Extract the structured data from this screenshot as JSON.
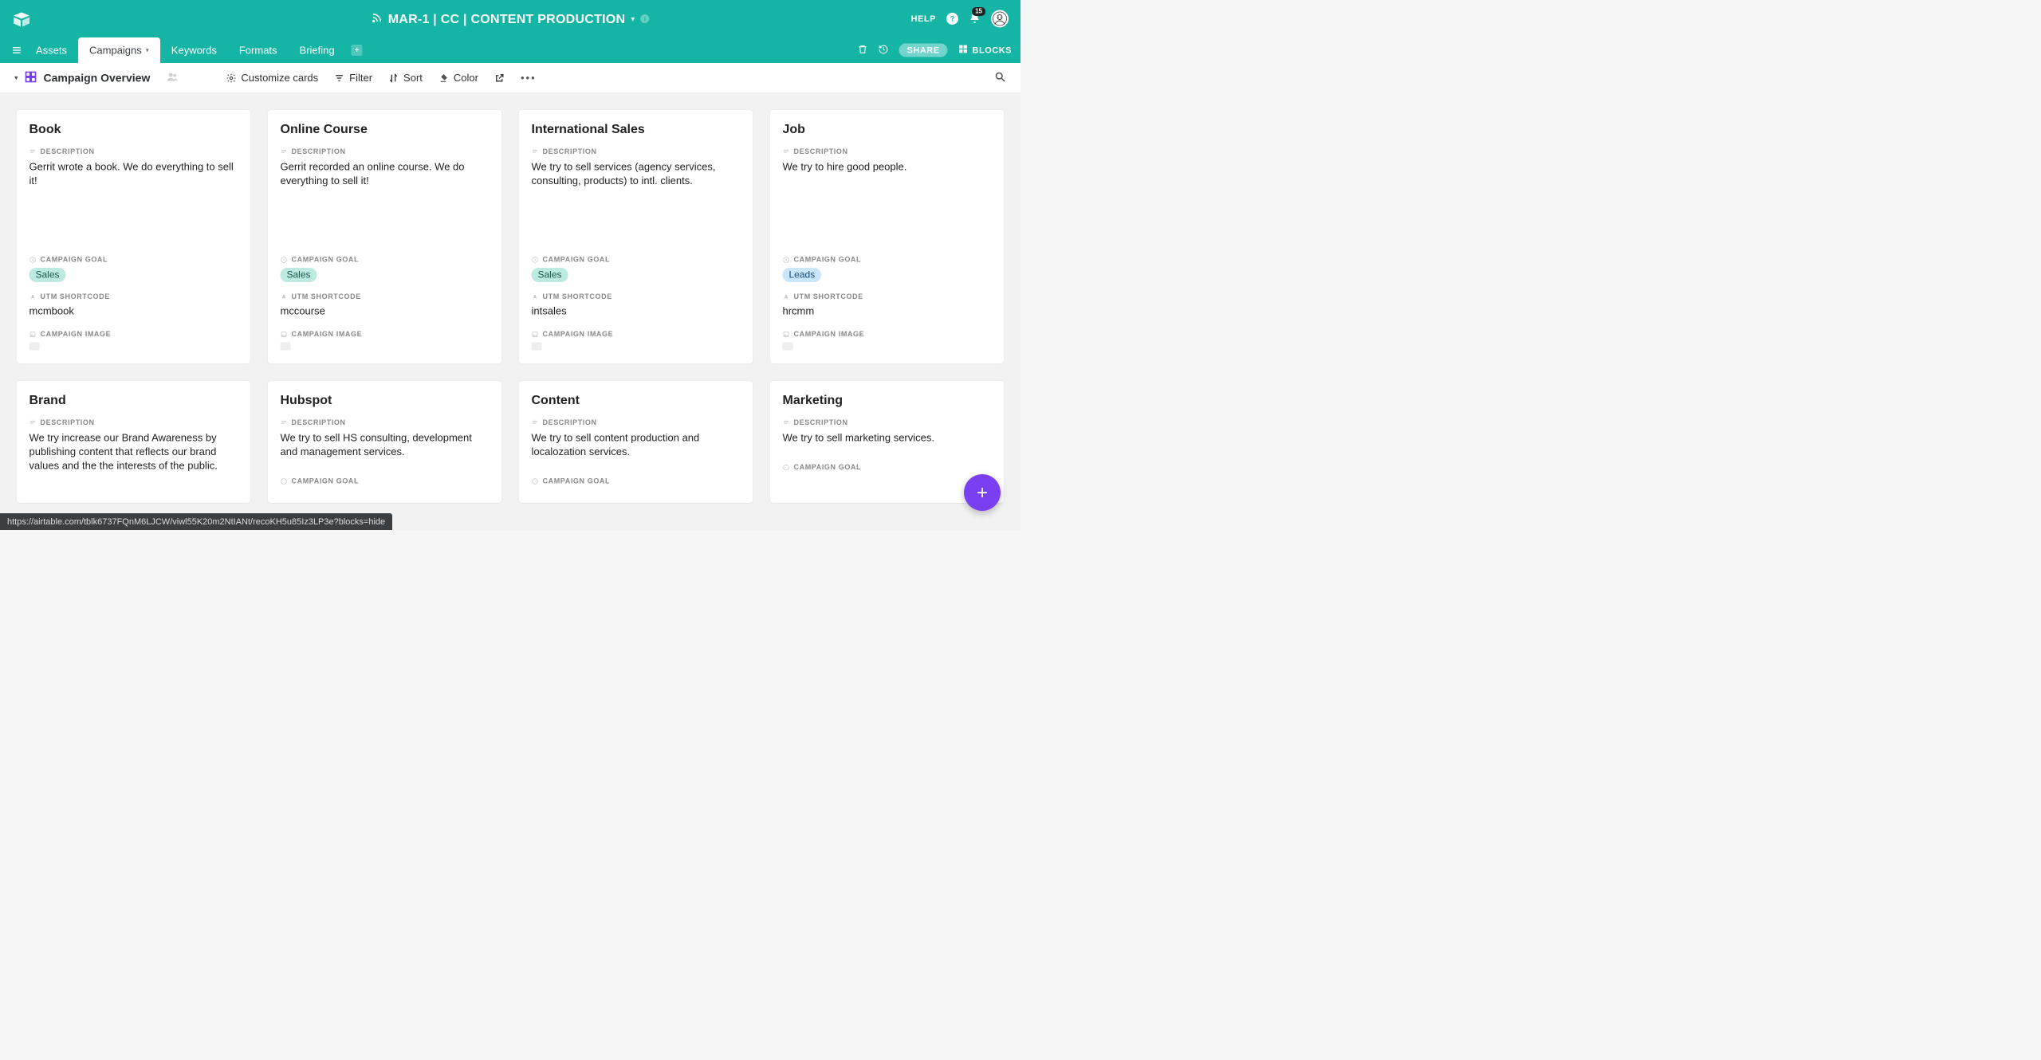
{
  "header": {
    "title": "MAR-1 | CC | CONTENT PRODUCTION",
    "help_label": "HELP",
    "notification_count": "15"
  },
  "tabs": {
    "items": [
      {
        "label": "Assets",
        "active": false
      },
      {
        "label": "Campaigns",
        "active": true
      },
      {
        "label": "Keywords",
        "active": false
      },
      {
        "label": "Formats",
        "active": false
      },
      {
        "label": "Briefing",
        "active": false
      }
    ],
    "share_label": "SHARE",
    "blocks_label": "BLOCKS"
  },
  "toolbar": {
    "view_name": "Campaign Overview",
    "customize": "Customize cards",
    "filter": "Filter",
    "sort": "Sort",
    "color": "Color"
  },
  "field_labels": {
    "description": "DESCRIPTION",
    "goal": "CAMPAIGN GOAL",
    "utm": "UTM SHORTCODE",
    "image": "CAMPAIGN IMAGE"
  },
  "cards": [
    {
      "title": "Book",
      "description": "Gerrit wrote a book. We do everything to sell it!",
      "goal": "Sales",
      "goal_class": "sales",
      "utm": "mcmbook"
    },
    {
      "title": "Online Course",
      "description": "Gerrit recorded an online course. We do everything to sell it!",
      "goal": "Sales",
      "goal_class": "sales",
      "utm": "mccourse"
    },
    {
      "title": "International Sales",
      "description": "We try to sell services (agency services, consulting, products) to intl. clients.",
      "goal": "Sales",
      "goal_class": "sales",
      "utm": "intsales"
    },
    {
      "title": "Job",
      "description": "We try to hire good people.",
      "goal": "Leads",
      "goal_class": "leads",
      "utm": "hrcmm"
    },
    {
      "title": "Brand",
      "description": "We try increase our Brand Awareness by publishing content that reflects our brand values and the the interests of the public."
    },
    {
      "title": "Hubspot",
      "description": "We try to sell HS consulting, development and management services."
    },
    {
      "title": "Content",
      "description": "We try to sell content production and localozation services."
    },
    {
      "title": "Marketing",
      "description": "We try to sell marketing services."
    }
  ],
  "status_url": "https://airtable.com/tblk6737FQnM6LJCW/viwl55K20m2NtIANt/recoKH5u85Iz3LP3e?blocks=hide"
}
